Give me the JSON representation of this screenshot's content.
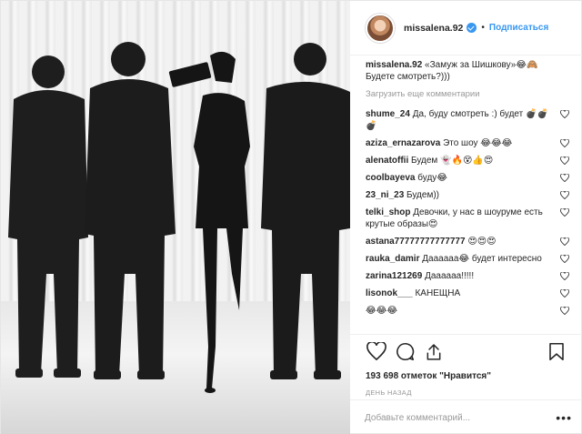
{
  "header": {
    "username": "missalena.92",
    "separator": "•",
    "follow_label": "Подписаться",
    "more_label": "•••"
  },
  "caption": {
    "username": "missalena.92",
    "text": "«Замуж за Шишкову»😂🙈 Будете смотреть?)))"
  },
  "load_more": "Загрузить еще комментарии",
  "comments": [
    {
      "username": "shume_24",
      "text": "Да, буду смотреть :) будет 💣💣💣"
    },
    {
      "username": "aziza_ernazarova",
      "text": "Это шоу 😂😂😂"
    },
    {
      "username": "alenatoffii",
      "text": "Будем 👻🔥😵👍😍"
    },
    {
      "username": "coolbayeva",
      "text": "буду😂"
    },
    {
      "username": "23_ni_23",
      "text": "Будем))"
    },
    {
      "username": "telki_shop",
      "text": "Девочки, у нас в шоуруме есть крутые образы😍"
    },
    {
      "username": "astana77777777777777",
      "text": "😍😍😍"
    },
    {
      "username": "rauka_damir",
      "text": "Даааааа😂 будет интересно"
    },
    {
      "username": "zarina121269",
      "text": "Даааааа!!!!!"
    },
    {
      "username": "lisonok___",
      "text": "КАНЕЩНА"
    },
    {
      "username": "",
      "text": "😂😂😂"
    }
  ],
  "likes": "193 698 отметок \"Нравится\"",
  "timestamp": "ДЕНЬ НАЗАД",
  "add_comment": {
    "placeholder": "Добавьте комментарий..."
  },
  "icons": [
    "heart-icon",
    "comment-icon",
    "share-icon",
    "bookmark-icon",
    "verified-icon",
    "more-options-icon"
  ],
  "colors": {
    "accent": "#3897f0",
    "muted": "#999999",
    "text": "#262626"
  }
}
